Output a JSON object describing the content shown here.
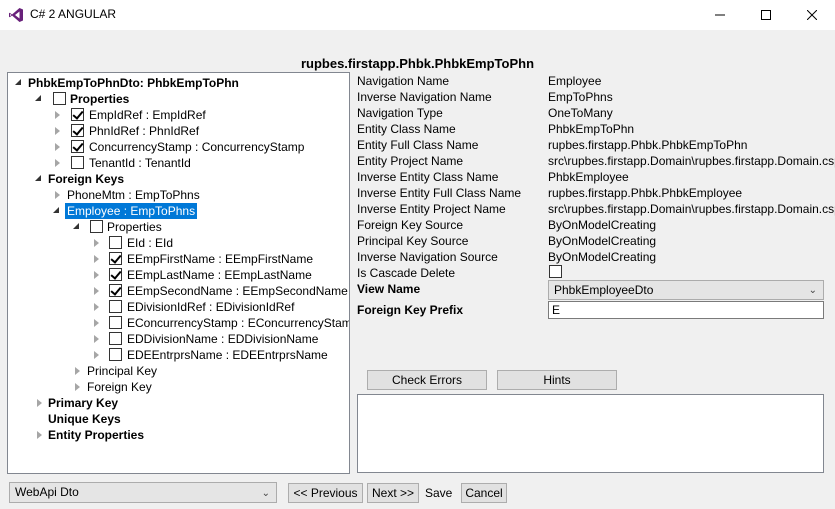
{
  "window": {
    "title": "C# 2 ANGULAR"
  },
  "header": {
    "title": "rupbes.firstapp.Phbk.PhbkEmpToPhn"
  },
  "tree": {
    "root": "PhbkEmpToPhnDto: PhbkEmpToPhn",
    "properties_label": "Properties",
    "properties": [
      {
        "label": "EmpIdRef : EmpIdRef",
        "checked": true
      },
      {
        "label": "PhnIdRef : PhnIdRef",
        "checked": true
      },
      {
        "label": "ConcurrencyStamp : ConcurrencyStamp",
        "checked": true
      },
      {
        "label": "TenantId : TenantId",
        "checked": false
      }
    ],
    "foreign_keys_label": "Foreign Keys",
    "foreign_keys": [
      {
        "label": "PhoneMtm : EmpToPhns"
      },
      {
        "label": "Employee : EmpToPhns",
        "selected": true
      }
    ],
    "employee_properties_label": "Properties",
    "employee_properties": [
      {
        "label": "EId : EId",
        "checked": false
      },
      {
        "label": "EEmpFirstName : EEmpFirstName",
        "checked": true
      },
      {
        "label": "EEmpLastName : EEmpLastName",
        "checked": true
      },
      {
        "label": "EEmpSecondName : EEmpSecondName",
        "checked": true
      },
      {
        "label": "EDivisionIdRef : EDivisionIdRef",
        "checked": false
      },
      {
        "label": "EConcurrencyStamp : EConcurrencyStamp",
        "checked": false
      },
      {
        "label": "EDDivisionName : EDDivisionName",
        "checked": false
      },
      {
        "label": "EDEEntrprsName : EDEEntrprsName",
        "checked": false
      }
    ],
    "principal_key_label": "Principal Key",
    "foreign_key_label": "Foreign Key",
    "primary_key_label": "Primary Key",
    "unique_keys_label": "Unique Keys",
    "entity_properties_label": "Entity Properties"
  },
  "details": [
    {
      "label": "Navigation Name",
      "value": "Employee"
    },
    {
      "label": "Inverse Navigation Name",
      "value": "EmpToPhns"
    },
    {
      "label": "Navigation Type",
      "value": "OneToMany"
    },
    {
      "label": "Entity Class Name",
      "value": "PhbkEmpToPhn"
    },
    {
      "label": "Entity Full Class Name",
      "value": "rupbes.firstapp.Phbk.PhbkEmpToPhn"
    },
    {
      "label": "Entity Project Name",
      "value": "src\\rupbes.firstapp.Domain\\rupbes.firstapp.Domain.csproj"
    },
    {
      "label": "Inverse Entity Class Name",
      "value": "PhbkEmployee"
    },
    {
      "label": "Inverse Entity Full Class Name",
      "value": "rupbes.firstapp.Phbk.PhbkEmployee"
    },
    {
      "label": "Inverse Entity Project Name",
      "value": "src\\rupbes.firstapp.Domain\\rupbes.firstapp.Domain.csproj"
    },
    {
      "label": "Foreign Key Source",
      "value": "ByOnModelCreating"
    },
    {
      "label": "Principal Key Source",
      "value": "ByOnModelCreating"
    },
    {
      "label": "Inverse Navigation Source",
      "value": "ByOnModelCreating"
    }
  ],
  "cascade": {
    "label": "Is Cascade Delete",
    "checked": false
  },
  "view_name": {
    "label": "View Name",
    "value": "PhbkEmployeeDto"
  },
  "fk_prefix": {
    "label": "Foreign Key Prefix",
    "value": "E"
  },
  "buttons": {
    "check_errors": "Check Errors",
    "hints": "Hints",
    "previous": "<< Previous",
    "next": "Next >>",
    "save": "Save",
    "cancel": "Cancel"
  },
  "bottom_select": {
    "value": "WebApi Dto"
  }
}
